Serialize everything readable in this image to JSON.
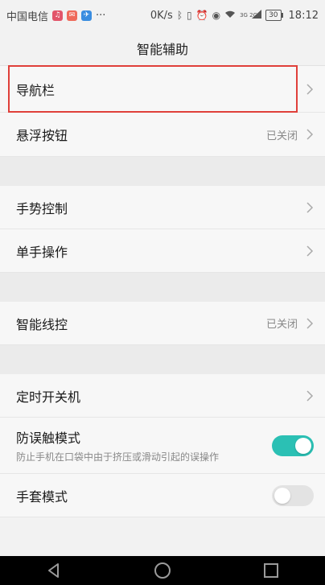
{
  "status_bar": {
    "carrier": "中国电信",
    "more": "···",
    "speed": "0K/s",
    "network": "3G 2G",
    "battery": "30",
    "time": "18:12",
    "icons": [
      "music-app-icon",
      "mail-app-icon",
      "app-icon",
      "bluetooth-icon",
      "vibrate-icon",
      "alarm-icon",
      "eye-icon",
      "wifi-icon",
      "signal-icon",
      "battery-icon"
    ]
  },
  "header": {
    "title": "智能辅助"
  },
  "items": {
    "nav_bar": {
      "label": "导航栏"
    },
    "float_button": {
      "label": "悬浮按钮",
      "value": "已关闭"
    },
    "gesture": {
      "label": "手势控制"
    },
    "one_hand": {
      "label": "单手操作"
    },
    "smart_wire": {
      "label": "智能线控",
      "value": "已关闭"
    },
    "timer_power": {
      "label": "定时开关机"
    },
    "anti_touch": {
      "label": "防误触模式",
      "description": "防止手机在口袋中由于挤压或滑动引起的误操作",
      "toggle_on": true
    },
    "glove_mode": {
      "label": "手套模式",
      "toggle_on": false
    }
  },
  "colors": {
    "accent": "#2bc0b4",
    "highlight": "#e0403a"
  },
  "navigation": {
    "icons": [
      "back-icon",
      "home-icon",
      "recents-icon"
    ]
  }
}
